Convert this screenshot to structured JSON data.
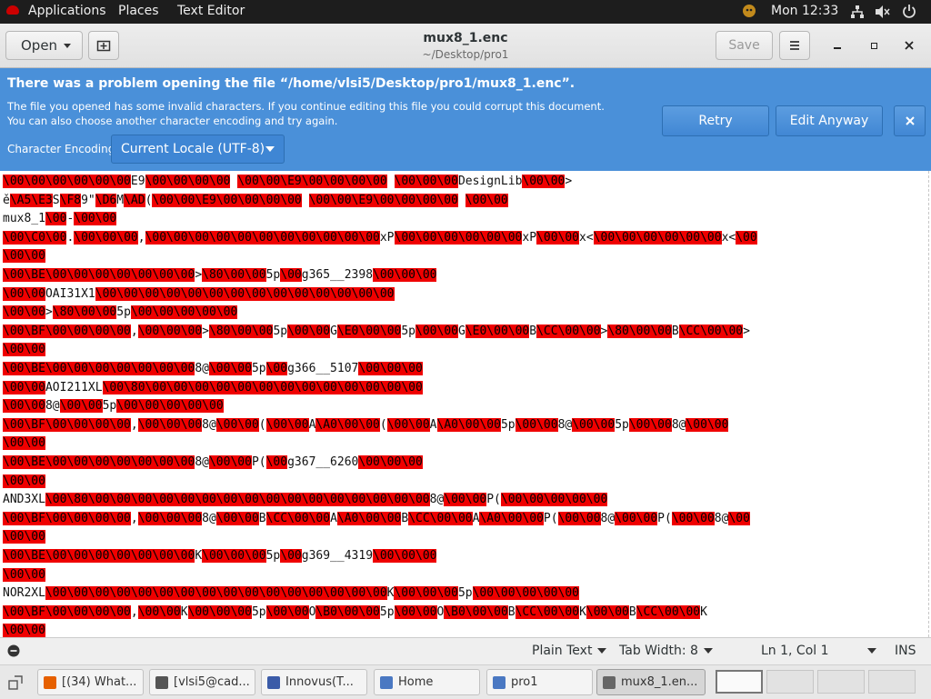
{
  "topbar": {
    "applications": "Applications",
    "places": "Places",
    "text_editor": "Text Editor",
    "clock": "Mon 12:33"
  },
  "headerbar": {
    "open_label": "Open",
    "title": "mux8_1.enc",
    "subtitle": "~/Desktop/pro1",
    "save_label": "Save"
  },
  "infobar": {
    "title": "There was a problem opening the file “/home/vlsi5/Desktop/pro1/mux8_1.enc”.",
    "line1": "The file you opened has some invalid characters. If you continue editing this file you could corrupt this document.",
    "line2": "You can also choose another character encoding and try again.",
    "encoding_label": "Character Encoding:",
    "encoding_value": "Current Locale (UTF-8)",
    "retry_label": "Retry",
    "edit_anyway_label": "Edit Anyway",
    "bg_color": "#4a90d9"
  },
  "editor": {
    "invalid_bg_color": "#ef0000",
    "lines": [
      "\\00\\00\\00\\00\\00\\00E9\\00\\00\\00\\00 \\00\\00\\E9\\00\\00\\00\\00 \\00\\00\\00DesignLib\\00\\00>",
      "ě\\A5\\E3S\\F89\"\\D6M\\AD(\\00\\00\\E9\\00\\00\\00\\00 \\00\\00\\E9\\00\\00\\00\\00 \\00\\00",
      "mux8_1\\00-\\00\\00",
      "\\00\\C0\\00.\\00\\00\\00,\\00\\00\\00\\00\\00\\00\\00\\00\\00\\00\\00xP\\00\\00\\00\\00\\00\\00xP\\00\\00x<\\00\\00\\00\\00\\00\\00x<\\00",
      "\\00\\00",
      "\\00\\BE\\00\\00\\00\\00\\00\\00\\00>\\80\\00\\005p\\00g365__2398\\00\\00\\00",
      "\\00\\00OAI31X1\\00\\00\\00\\00\\00\\00\\00\\00\\00\\00\\00\\00\\00\\00",
      "\\00\\00>\\80\\00\\005p\\00\\00\\00\\00\\00",
      "\\00\\BF\\00\\00\\00\\00,\\00\\00\\00>\\80\\00\\005p\\00\\00G\\E0\\00\\005p\\00\\00G\\E0\\00\\00B\\CC\\00\\00>\\80\\00\\00B\\CC\\00\\00>",
      "\\00\\00",
      "\\00\\BE\\00\\00\\00\\00\\00\\00\\008@\\00\\005p\\00g366__5107\\00\\00\\00",
      "\\00\\00AOI211XL\\00\\80\\00\\00\\00\\00\\00\\00\\00\\00\\00\\00\\00\\00\\00",
      "\\00\\008@\\00\\005p\\00\\00\\00\\00\\00",
      "\\00\\BF\\00\\00\\00\\00,\\00\\00\\008@\\00\\00(\\00\\00A\\A0\\00\\00(\\00\\00A\\A0\\00\\005p\\00\\008@\\00\\005p\\00\\008@\\00\\00",
      "\\00\\00",
      "\\00\\BE\\00\\00\\00\\00\\00\\00\\008@\\00\\00P(\\00g367__6260\\00\\00\\00",
      "\\00\\00",
      "AND3XL\\00\\80\\00\\00\\00\\00\\00\\00\\00\\00\\00\\00\\00\\00\\00\\00\\00\\008@\\00\\00P(\\00\\00\\00\\00\\00",
      "\\00\\BF\\00\\00\\00\\00,\\00\\00\\008@\\00\\00B\\CC\\00\\00A\\A0\\00\\00B\\CC\\00\\00A\\A0\\00\\00P(\\00\\008@\\00\\00P(\\00\\008@\\00",
      "\\00\\00",
      "\\00\\BE\\00\\00\\00\\00\\00\\00\\00K\\00\\00\\005p\\00g369__4319\\00\\00\\00",
      "\\00\\00",
      "NOR2XL\\00\\00\\00\\00\\00\\00\\00\\00\\00\\00\\00\\00\\00\\00\\00\\00K\\00\\00\\005p\\00\\00\\00\\00\\00",
      "\\00\\BF\\00\\00\\00\\00,\\00\\00K\\00\\00\\005p\\00\\00O\\B0\\00\\005p\\00\\00O\\B0\\00\\00B\\CC\\00\\00K\\00\\00B\\CC\\00\\00K",
      "\\00\\00"
    ]
  },
  "statusbar": {
    "language": "Plain Text",
    "tab_width": "Tab Width: 8",
    "position": "Ln 1, Col 1",
    "mode": "INS"
  },
  "taskbar": {
    "tasks": [
      {
        "label": "[(34) What...",
        "icon": "firefox-icon",
        "color": "#e66000"
      },
      {
        "label": "[vlsi5@cad...",
        "icon": "terminal-icon",
        "color": "#555555"
      },
      {
        "label": "Innovus(T...",
        "icon": "innovus-window-icon",
        "color": "#3b5ba8"
      },
      {
        "label": "Home",
        "icon": "file-manager-icon",
        "color": "#4a78c2"
      },
      {
        "label": "pro1",
        "icon": "file-manager-icon",
        "color": "#4a78c2"
      },
      {
        "label": "mux8_1.en...",
        "icon": "text-editor-icon",
        "color": "#666666"
      }
    ]
  }
}
